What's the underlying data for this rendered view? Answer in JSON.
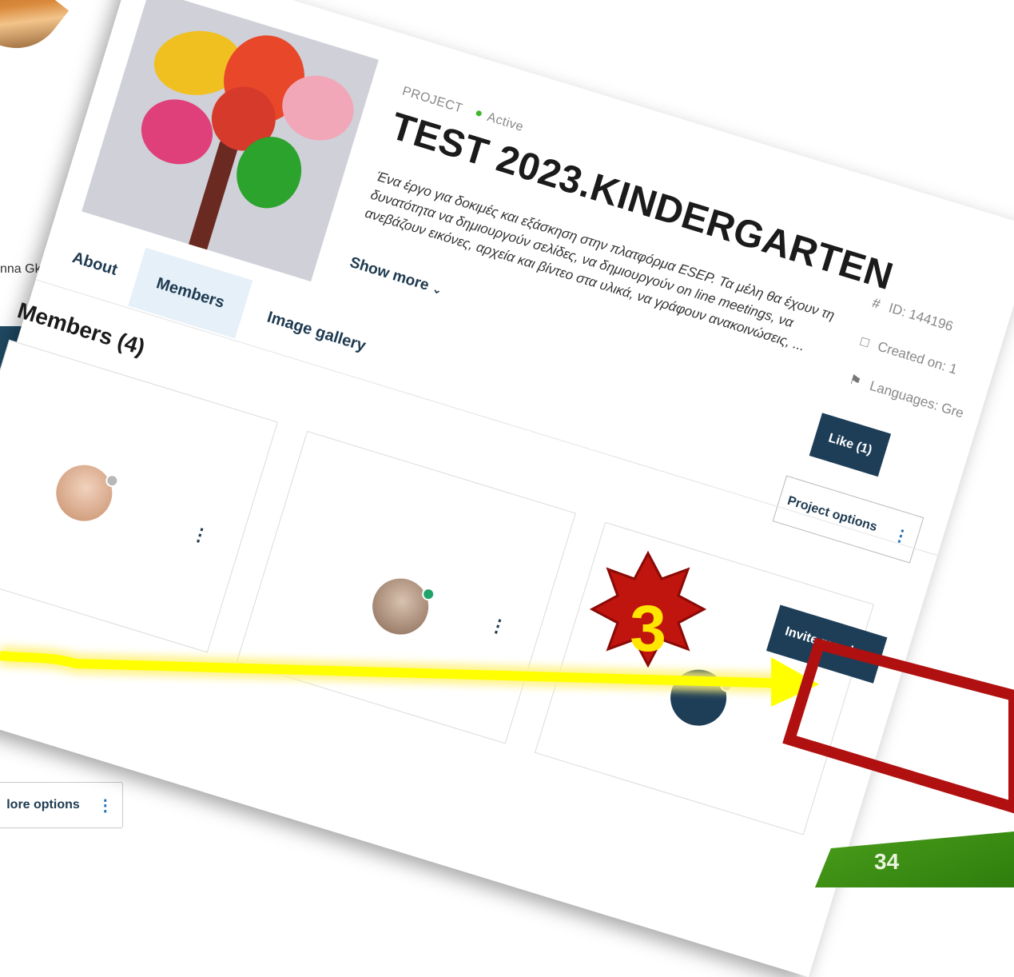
{
  "background_page": {
    "user_name": "nna Gkini",
    "more_options_label": "lore options",
    "page_number": "34"
  },
  "project": {
    "eyebrow": "PROJECT",
    "status": "Active",
    "title": "TEST 2023.KINDERGARTEN",
    "description": "Ένα έργο για δοκιμές και εξάσκηση στην πλατφόρμα ESEP. Τα μέλη θα έχουν τη δυνατότητα να δημιουργούν σελίδες, να δημιουργούν on line meetings, να ανεβάζουν εικόνες, αρχεία και βίντεο στα υλικά, να γράφουν ανακοινώσεις, ...",
    "show_more_label": "Show more",
    "meta": {
      "id": "ID: 144196",
      "created": "Created on: 1",
      "languages": "Languages: Gre"
    },
    "like_label": "Like (1)",
    "options_label": "Project options"
  },
  "tabs": [
    {
      "label": "About"
    },
    {
      "label": "Members",
      "active": true
    },
    {
      "label": "Image gallery"
    }
  ],
  "members": {
    "heading": "Members (4)",
    "invite_label": "Invite member"
  },
  "annotation": {
    "step_number": "3",
    "arrow_color": "#ffff00",
    "badge_color": "#c0140e",
    "highlight_color": "#b01010"
  }
}
